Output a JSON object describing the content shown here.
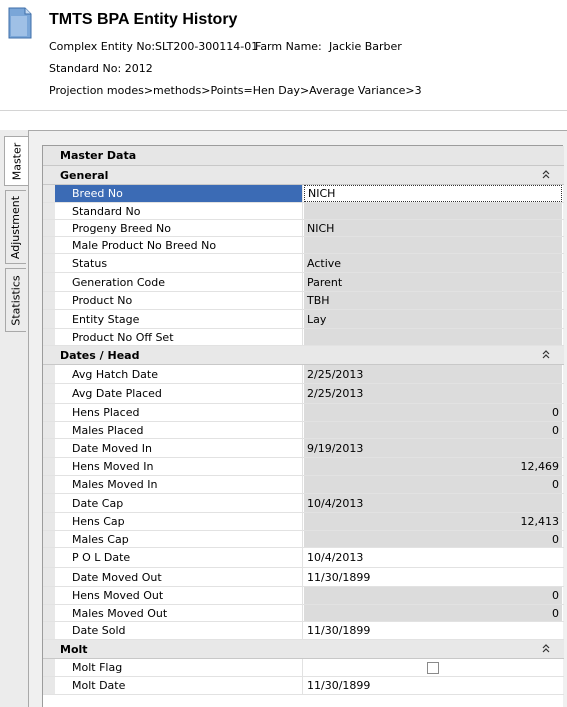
{
  "header": {
    "title": "TMTS BPA Entity History",
    "complex_entity": "Complex Entity No:SLT200-300114-01",
    "farm_name_label": "Farm Name:",
    "farm_name_value": "Jackie Barber",
    "standard_no": "Standard No: 2012",
    "projection": "Projection modes>methods>Points=Hen Day>Average Variance>3",
    "icon": "document-icon"
  },
  "tabs": [
    {
      "label": "Master",
      "active": true
    },
    {
      "label": "Adjustment",
      "active": false
    },
    {
      "label": "Statistics",
      "active": false
    }
  ],
  "grid": {
    "title": "Master Data",
    "collapse_icon": "double-chevron-up-icon",
    "sections": [
      {
        "label": "General",
        "rows": [
          {
            "name": "Breed No",
            "value": "NICH",
            "ro": false,
            "num": false,
            "selected": true
          },
          {
            "name": "Standard No",
            "value": "",
            "ro": true,
            "num": false
          },
          {
            "name": "Progeny Breed No",
            "value": "NICH",
            "ro": true,
            "num": false
          },
          {
            "name": "Male Product No Breed No",
            "value": "",
            "ro": true,
            "num": false
          },
          {
            "name": "Status",
            "value": "Active",
            "ro": true,
            "num": false
          },
          {
            "name": "Generation Code",
            "value": "Parent",
            "ro": true,
            "num": false
          },
          {
            "name": "Product No",
            "value": "TBH",
            "ro": true,
            "num": false
          },
          {
            "name": "Entity Stage",
            "value": "Lay",
            "ro": true,
            "num": false
          },
          {
            "name": "Product No Off Set",
            "value": "",
            "ro": true,
            "num": false
          }
        ]
      },
      {
        "label": "Dates / Head",
        "rows": [
          {
            "name": "Avg Hatch Date",
            "value": "2/25/2013",
            "ro": true,
            "num": false
          },
          {
            "name": "Avg Date Placed",
            "value": "2/25/2013",
            "ro": true,
            "num": false
          },
          {
            "name": "Hens Placed",
            "value": "0",
            "ro": true,
            "num": true
          },
          {
            "name": "Males Placed",
            "value": "0",
            "ro": true,
            "num": true
          },
          {
            "name": "Date Moved In",
            "value": "9/19/2013",
            "ro": true,
            "num": false
          },
          {
            "name": "Hens Moved In",
            "value": "12,469",
            "ro": true,
            "num": true
          },
          {
            "name": "Males Moved In",
            "value": "0",
            "ro": true,
            "num": true
          },
          {
            "name": "Date Cap",
            "value": "10/4/2013",
            "ro": true,
            "num": false
          },
          {
            "name": "Hens Cap",
            "value": "12,413",
            "ro": true,
            "num": true
          },
          {
            "name": "Males Cap",
            "value": "0",
            "ro": true,
            "num": true
          },
          {
            "name": "P O L Date",
            "value": "10/4/2013",
            "ro": false,
            "num": false
          },
          {
            "name": "Date Moved Out",
            "value": "11/30/1899",
            "ro": false,
            "num": false
          },
          {
            "name": "Hens Moved Out",
            "value": "0",
            "ro": true,
            "num": true
          },
          {
            "name": "Males Moved Out",
            "value": "0",
            "ro": true,
            "num": true
          },
          {
            "name": "Date Sold",
            "value": "11/30/1899",
            "ro": false,
            "num": false
          }
        ]
      },
      {
        "label": "Molt",
        "rows": [
          {
            "name": "Molt Flag",
            "value": "",
            "ro": false,
            "num": false,
            "checkbox": true
          },
          {
            "name": "Molt Date",
            "value": "11/30/1899",
            "ro": false,
            "num": false
          }
        ]
      }
    ]
  }
}
